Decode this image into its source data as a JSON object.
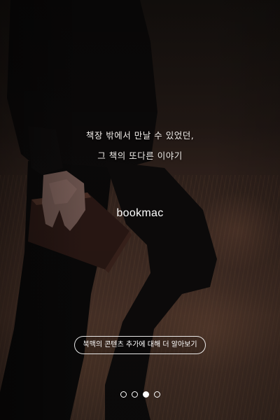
{
  "tagline": {
    "line1": "책장 밖에서 만날 수 있었던,",
    "line2": "그 책의 또다른 이야기"
  },
  "brand": {
    "logo_text": "bookmac"
  },
  "cta": {
    "label": "북맥의 콘텐츠 추가에 대해 더 알아보기"
  },
  "pager": {
    "count": 4,
    "active_index": 2
  },
  "colors": {
    "text": "#ffffff",
    "background_dark": "#120d0b",
    "background_warm": "#4a3329"
  }
}
